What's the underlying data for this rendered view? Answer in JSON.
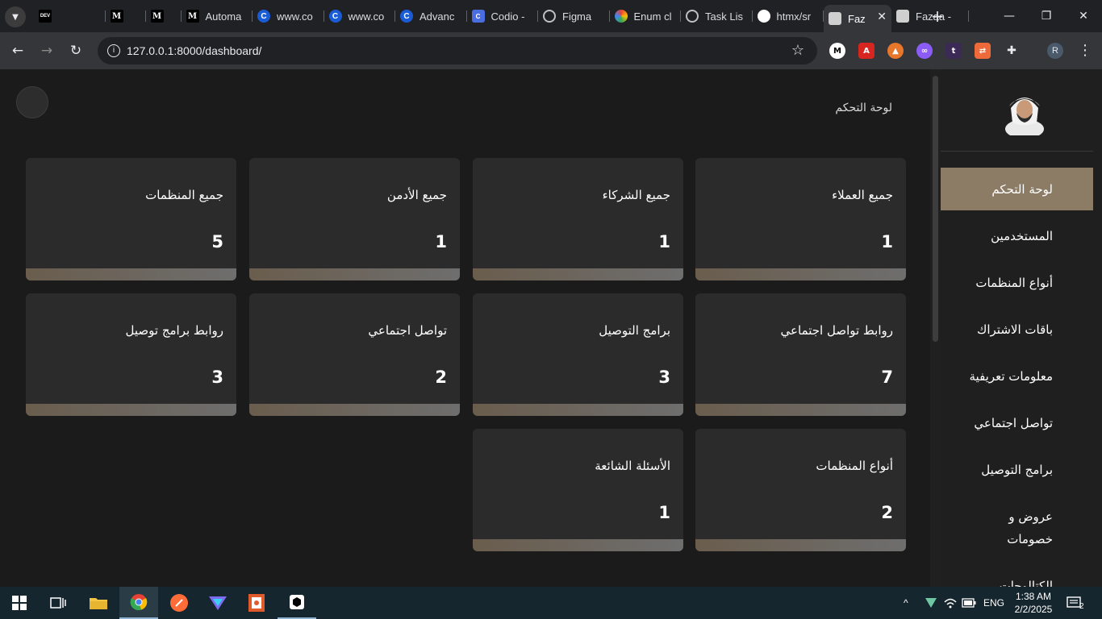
{
  "browser": {
    "tabs": [
      {
        "icon": "dev-icon",
        "label": ""
      },
      {
        "icon": "medium-icon",
        "label": ""
      },
      {
        "icon": "medium-icon",
        "label": ""
      },
      {
        "icon": "medium-icon",
        "label": "Automa"
      },
      {
        "icon": "c-icon",
        "label": "www.co"
      },
      {
        "icon": "c-icon",
        "label": "www.co"
      },
      {
        "icon": "c-icon",
        "label": "Advanc"
      },
      {
        "icon": "codio-icon",
        "label": "Codio -"
      },
      {
        "icon": "globe-icon",
        "label": "Figma"
      },
      {
        "icon": "enum-icon",
        "label": "Enum cl"
      },
      {
        "icon": "globe-icon",
        "label": "Task Lis"
      },
      {
        "icon": "github-icon",
        "label": "htmx/sr"
      },
      {
        "icon": "avatar-icon",
        "label": "Faz"
      },
      {
        "icon": "avatar-icon",
        "label": "Fazaa -"
      }
    ],
    "url": "127.0.0.1:8000/dashboard/"
  },
  "page": {
    "title": "لوحة التحكم"
  },
  "cards": [
    {
      "title": "جميع العملاء",
      "value": "1"
    },
    {
      "title": "جميع الشركاء",
      "value": "1"
    },
    {
      "title": "جميع الأدمن",
      "value": "1"
    },
    {
      "title": "جميع المنظمات",
      "value": "5"
    },
    {
      "title": "روابط تواصل اجتماعي",
      "value": "7"
    },
    {
      "title": "برامج التوصيل",
      "value": "3"
    },
    {
      "title": "تواصل اجتماعي",
      "value": "2"
    },
    {
      "title": "روابط برامج توصيل",
      "value": "3"
    },
    {
      "title": "أنواع المنظمات",
      "value": "2"
    },
    {
      "title": "الأسئلة الشائعة",
      "value": "1"
    }
  ],
  "sidebar": {
    "items": [
      {
        "label": "لوحة التحكم",
        "active": true
      },
      {
        "label": "المستخدمين"
      },
      {
        "label": "أنواع المنظمات"
      },
      {
        "label": "باقات الاشتراك"
      },
      {
        "label": "معلومات تعريفية"
      },
      {
        "label": "تواصل اجتماعي"
      },
      {
        "label": "برامج التوصيل"
      },
      {
        "label": "عروض و خصومات"
      },
      {
        "label": "الكتالوجات"
      }
    ]
  },
  "taskbar": {
    "lang": "ENG",
    "time": "1:38 AM",
    "date": "2/2/2025",
    "notifications": "2"
  },
  "colors": {
    "accent": "#8c7b65",
    "card_bg": "#2b2b2b",
    "page_bg": "#1b1b1b"
  }
}
